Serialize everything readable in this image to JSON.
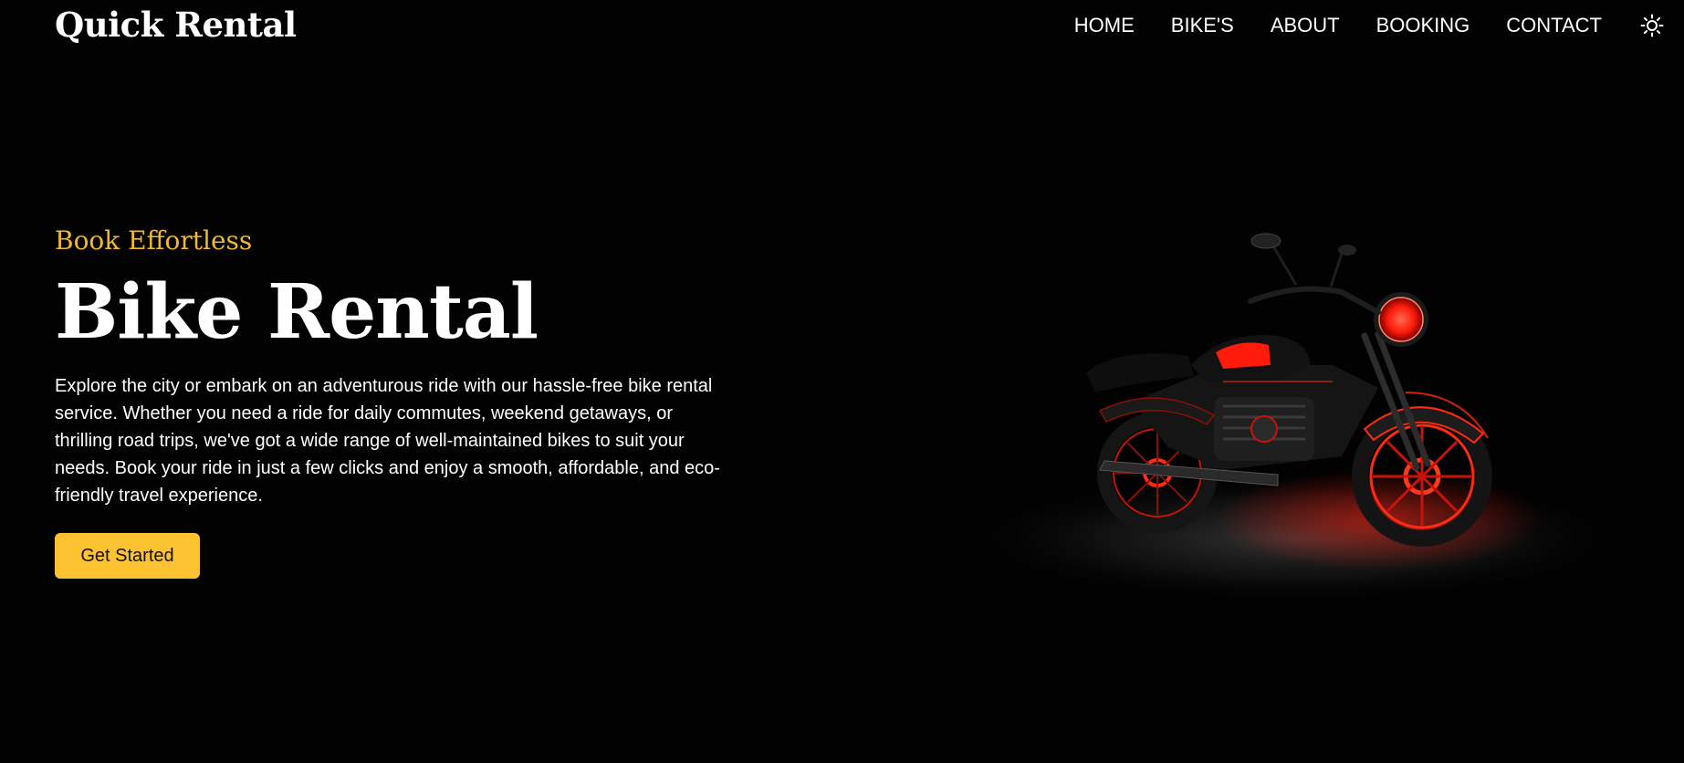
{
  "brand": {
    "name": "Quick Rental"
  },
  "nav": {
    "items": [
      {
        "label": "HOME"
      },
      {
        "label": "BIKE'S"
      },
      {
        "label": "ABOUT"
      },
      {
        "label": "BOOKING"
      },
      {
        "label": "CONTACT"
      }
    ],
    "theme_toggle_icon": "sun-icon"
  },
  "hero": {
    "eyebrow": "Book Effortless",
    "title": "Bike Rental",
    "description": "Explore the city or embark on an adventurous ride with our hassle-free bike rental service. Whether you need a ride for daily commutes, weekend getaways, or thrilling road trips, we've got a wide range of well-maintained bikes to suit your needs. Book your ride in just a few clicks and enjoy a smooth, affordable, and eco-friendly travel experience.",
    "cta_label": "Get Started",
    "image": {
      "subject": "black-and-red-cruiser-motorcycle"
    }
  },
  "colors": {
    "background": "#020202",
    "accent": "#fdc22f",
    "eyebrow": "#f2b92c",
    "text": "#ffffff",
    "bike_glow": "#ff1a0a"
  }
}
